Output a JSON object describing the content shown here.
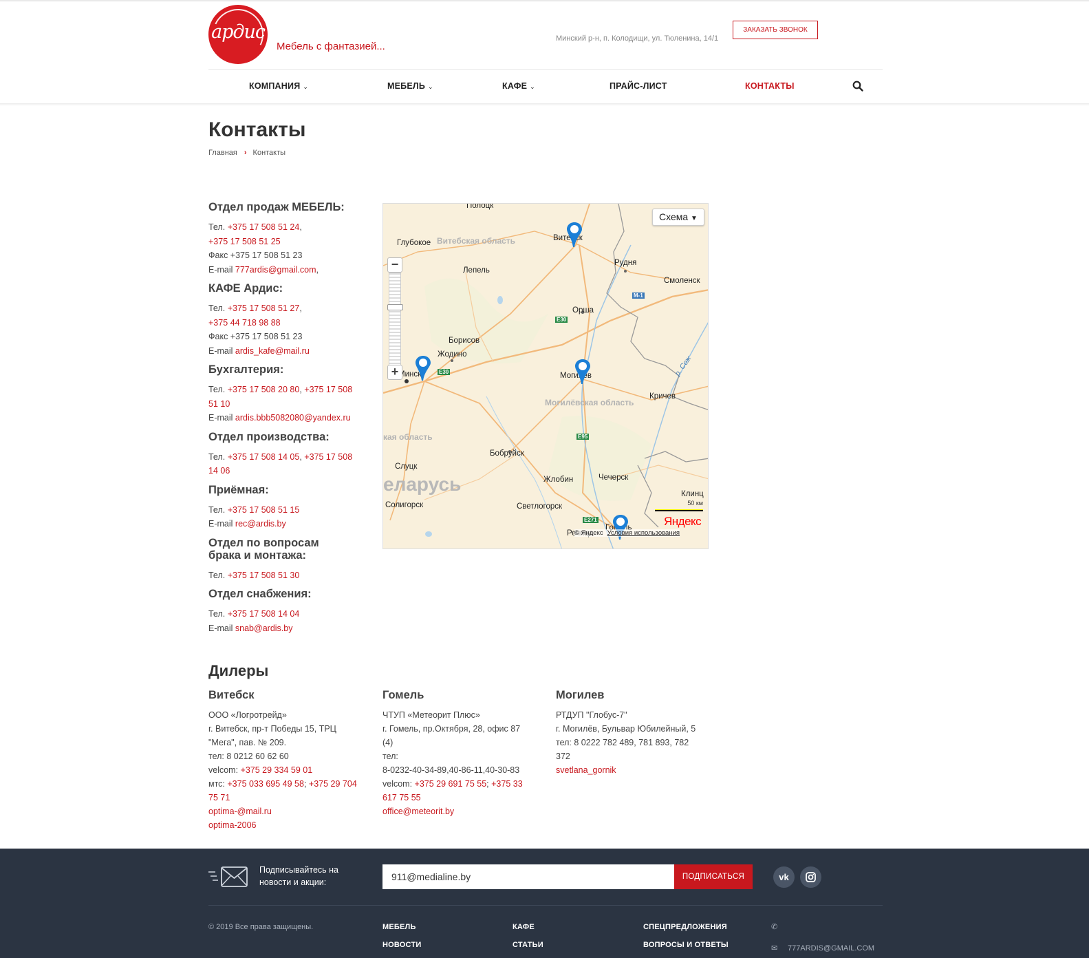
{
  "header": {
    "logo_text": "ардис",
    "slogan": "Мебель с фантазией...",
    "address": "Минский р-н, п. Колодищи, ул. Тюленина, 14/1",
    "callback_label": "ЗАКАЗАТЬ ЗВОНОК"
  },
  "nav": {
    "items": [
      {
        "label": "КОМПАНИЯ",
        "has_dropdown": true
      },
      {
        "label": "МЕБЕЛЬ",
        "has_dropdown": true
      },
      {
        "label": "КАФЕ",
        "has_dropdown": true
      },
      {
        "label": "ПРАЙС-ЛИСТ",
        "has_dropdown": false
      },
      {
        "label": "КОНТАКТЫ",
        "has_dropdown": false,
        "active": true
      }
    ],
    "search_icon": "search-icon"
  },
  "page": {
    "title": "Контакты",
    "breadcrumb": [
      "Главная",
      "Контакты"
    ]
  },
  "contacts": [
    {
      "title": "Отдел продаж МЕБЕЛЬ:",
      "lines": [
        [
          {
            "t": "Тел. "
          },
          {
            "l": "+375 17 508 51 24"
          },
          {
            "t": ","
          }
        ],
        [
          {
            "l": "+375 17 508 51 25"
          }
        ],
        [
          {
            "t": "Факс +375 17 508 51 23"
          }
        ],
        [
          {
            "t": "E-mail "
          },
          {
            "l": "777ardis@gmail.com"
          },
          {
            "t": ","
          }
        ]
      ]
    },
    {
      "title": "КАФЕ Ардис:",
      "lines": [
        [
          {
            "t": "Тел. "
          },
          {
            "l": "+375 17 508 51 27"
          },
          {
            "t": ","
          }
        ],
        [
          {
            "l": "+375 44 718 98 88"
          }
        ],
        [
          {
            "t": "Факс +375 17 508 51 23"
          }
        ],
        [
          {
            "t": "E-mail "
          },
          {
            "l": "ardis_kafe@mail.ru"
          }
        ]
      ]
    },
    {
      "title": "Бухгалтерия:",
      "lines": [
        [
          {
            "t": "Тел. "
          },
          {
            "l": "+375 17 508 20 80"
          },
          {
            "t": ", "
          },
          {
            "l": "+375 17 508"
          }
        ],
        [
          {
            "l": "51 10"
          }
        ],
        [
          {
            "t": "E-mail "
          },
          {
            "l": "ardis.bbb5082080@yandex.ru"
          }
        ]
      ]
    },
    {
      "title": "Отдел производства:",
      "lines": [
        [
          {
            "t": "Тел. "
          },
          {
            "l": "+375 17 508 14 05"
          },
          {
            "t": ", "
          },
          {
            "l": "+375 17 508"
          }
        ],
        [
          {
            "l": "14 06"
          }
        ]
      ]
    },
    {
      "title": "Приёмная:",
      "lines": [
        [
          {
            "t": "Тел. "
          },
          {
            "l": "+375 17 508 51 15"
          }
        ],
        [
          {
            "t": "E-mail "
          },
          {
            "l": "rec@ardis.by"
          }
        ]
      ]
    },
    {
      "title": "Отдел по вопросам брака и монтажа:",
      "lines": [
        [
          {
            "t": "Тел. "
          },
          {
            "l": "+375 17 508 51 30"
          }
        ]
      ]
    },
    {
      "title": "Отдел снабжения:",
      "lines": [
        [
          {
            "t": "Тел. "
          },
          {
            "l": "+375 17 508 14 04"
          }
        ],
        [
          {
            "t": "E-mail "
          },
          {
            "l": "snab@ardis.by"
          }
        ]
      ]
    }
  ],
  "map": {
    "scheme_label": "Схема",
    "cities": [
      "Полоцк",
      "Глубокое",
      "Витебск",
      "Рудня",
      "Смоленск",
      "Лепель",
      "Орша",
      "Борисов",
      "Жодино",
      "Минск",
      "Могилев",
      "Кричев",
      "Бобруйск",
      "Слуцк",
      "Жлобин",
      "Чечерск",
      "Солигорск",
      "Светлогорск",
      "Клинц",
      "Речица",
      "Гомель"
    ],
    "regions": [
      "Витебская область",
      "Могилёвская область",
      "кая область"
    ],
    "country": "еларусь",
    "roads": [
      "M-1",
      "E30",
      "E30",
      "E95",
      "E271"
    ],
    "river": "р. Сож",
    "scale_label": "50 км",
    "yandex_logo": "Яндекс",
    "copyright": "© Яндекс",
    "terms": "Условия использования",
    "zoom_in": "+",
    "zoom_out": "−"
  },
  "dealers": {
    "title": "Дилеры",
    "items": [
      {
        "city": "Витебск",
        "lines": [
          [
            {
              "t": "ООО «Логротрейд»"
            }
          ],
          [
            {
              "t": "г. Витебск, пр-т Победы 15, ТРЦ"
            }
          ],
          [
            {
              "t": "\"Мега\", пав. № 209."
            }
          ],
          [
            {
              "t": "тел: 8 0212 60 62 60"
            }
          ],
          [
            {
              "t": "velcom: "
            },
            {
              "l": "+375 29 334 59 01"
            }
          ],
          [
            {
              "t": "мтс: "
            },
            {
              "l": "+375 033 695 49 58"
            },
            {
              "t": "; "
            },
            {
              "l": "+375 29 704"
            }
          ],
          [
            {
              "l": "75 71"
            }
          ],
          [
            {
              "l": "optima-@mail.ru"
            }
          ],
          [
            {
              "l": "optima-2006"
            }
          ]
        ]
      },
      {
        "city": "Гомель",
        "lines": [
          [
            {
              "t": "ЧТУП «Метеорит Плюс»"
            }
          ],
          [
            {
              "t": "г. Гомель, пр.Октября, 28, офис 87"
            }
          ],
          [
            {
              "t": "(4)"
            }
          ],
          [
            {
              "t": "тел:"
            }
          ],
          [
            {
              "t": "8-0232-40-34-89,40-86-11,40-30-83"
            }
          ],
          [
            {
              "t": "velcom: "
            },
            {
              "l": "+375 29 691 75 55"
            },
            {
              "t": "; "
            },
            {
              "l": "+375 33"
            }
          ],
          [
            {
              "l": "617 75 55"
            }
          ],
          [
            {
              "l": "office@meteorit.by"
            }
          ]
        ]
      },
      {
        "city": "Могилев",
        "lines": [
          [
            {
              "t": "РТДУП \"Глобус-7\""
            }
          ],
          [
            {
              "t": "г. Могилёв, Бульвар Юбилейный, 5"
            }
          ],
          [
            {
              "t": "тел: 8 0222 782 489, 781 893, 782"
            }
          ],
          [
            {
              "t": "372"
            }
          ],
          [
            {
              "l": "svetlana_gornik"
            }
          ]
        ]
      }
    ]
  },
  "footer": {
    "subscribe_text_1": "Подписывайтесь на",
    "subscribe_text_2": "новости и акции:",
    "email_value": "911@medialine.by",
    "subscribe_button": "ПОДПИСАТЬСЯ",
    "social": [
      "vk-icon",
      "instagram-icon"
    ],
    "vk_label": "vk",
    "copyright": "© 2019 Все права защищены.",
    "links": [
      "МЕБЕЛЬ",
      "КАФЕ",
      "СПЕЦПРЕДЛОЖЕНИЯ",
      "НОВОСТИ",
      "СТАТЬИ",
      "ВОПРОСЫ И ОТВЕТЫ"
    ],
    "email": "777ARDIS@GMAIL.COM"
  },
  "colors": {
    "accent": "#c8181e",
    "footer_bg": "#2b3442",
    "text": "#444444"
  }
}
